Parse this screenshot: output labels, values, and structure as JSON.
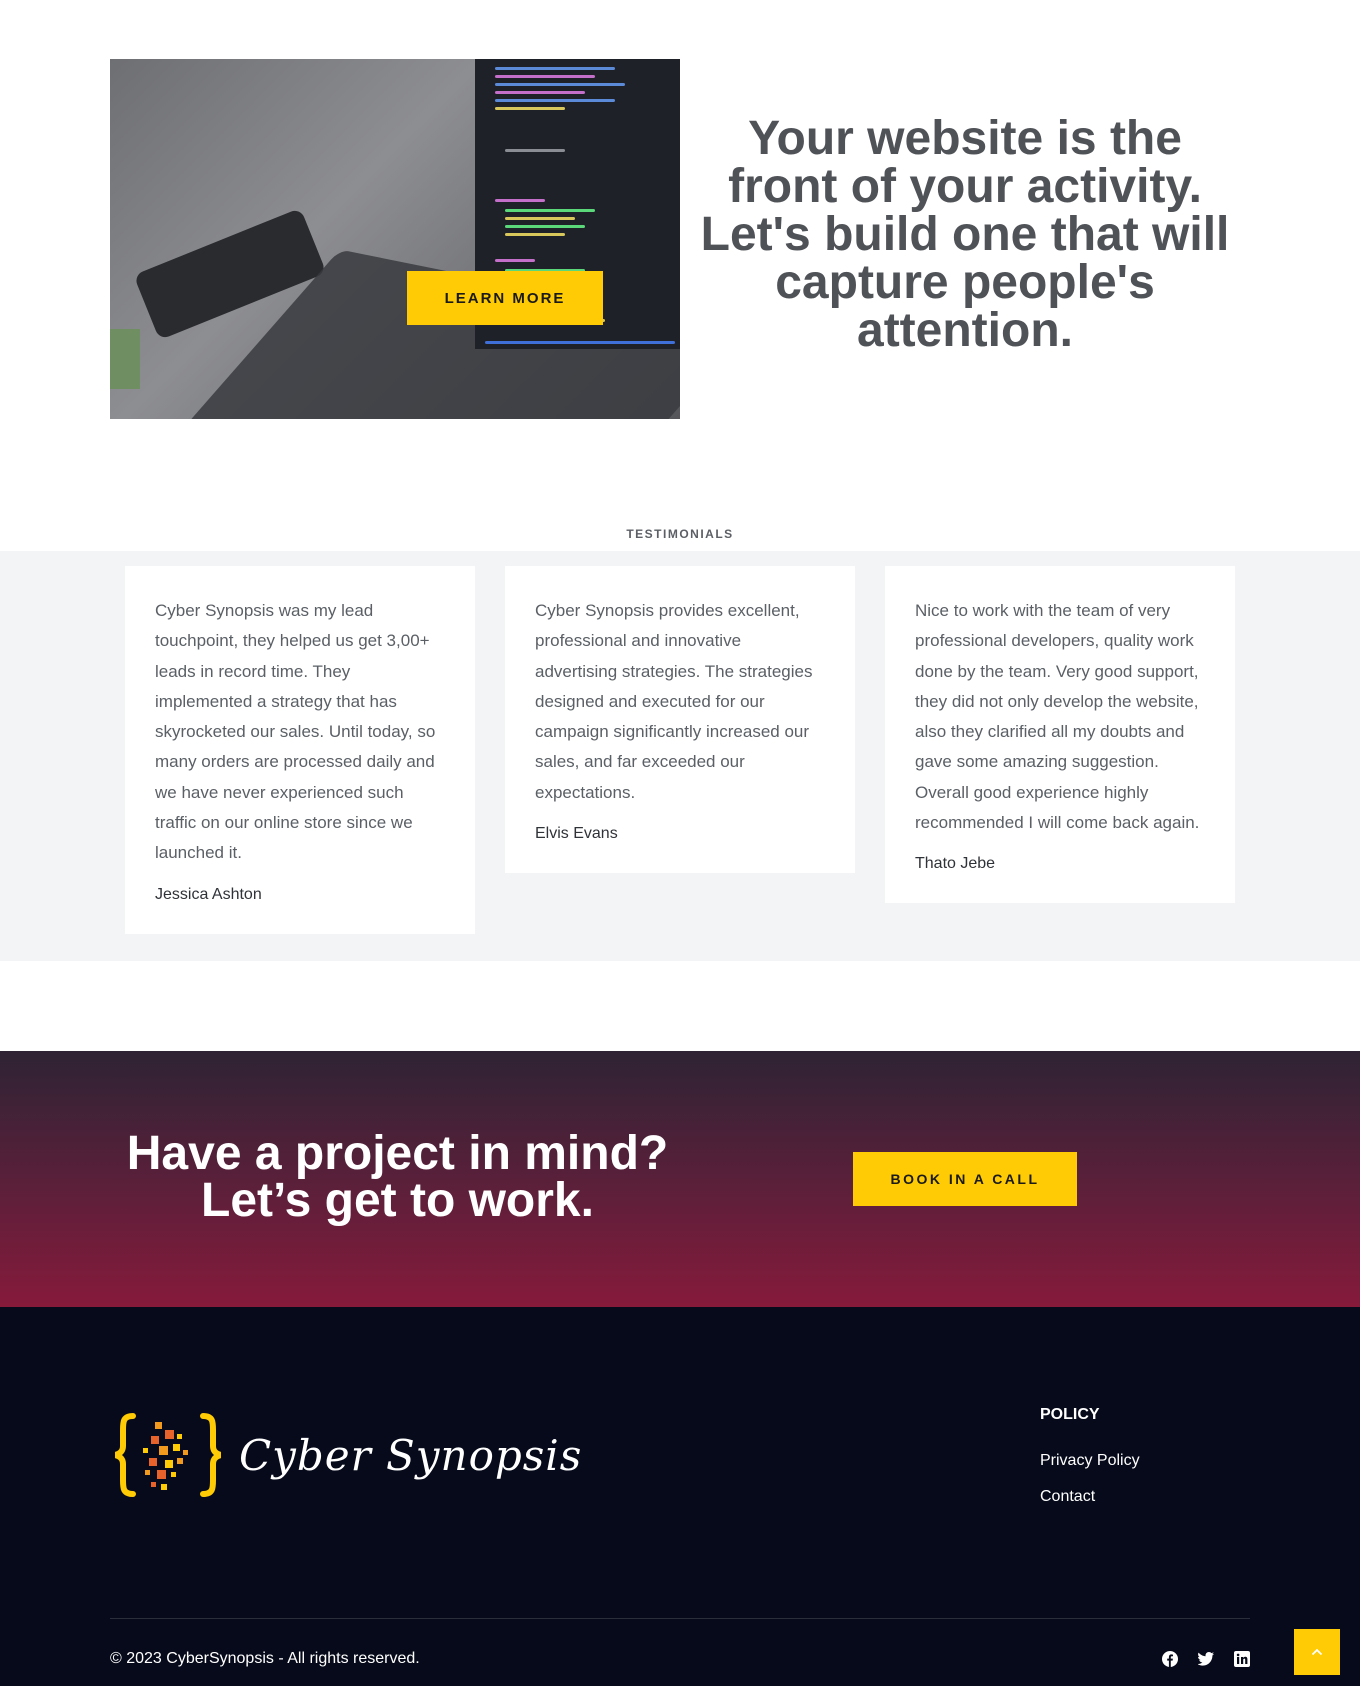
{
  "hero": {
    "learn_more_label": "LEARN MORE",
    "heading": "Your website is the front of your activity. Let's build one that will capture people's attention."
  },
  "testimonials": {
    "label": "TESTIMONIALS",
    "items": [
      {
        "text": "Cyber Synopsis was my lead touchpoint, they helped us get 3,00+ leads in record time. They implemented a strategy that has skyrocketed our sales. Until today, so many orders are processed daily and we have never experienced such traffic on our online store since we launched it.",
        "author": "Jessica Ashton"
      },
      {
        "text": "Cyber Synopsis provides excellent, professional and innovative advertising strategies. The strategies designed and executed for our campaign significantly increased our sales, and far exceeded our expectations.",
        "author": "Elvis Evans"
      },
      {
        "text": "Nice to work with the team of very professional developers, quality work done by the team. Very good support, they did not only develop the website, also they clarified all my doubts and gave some amazing suggestion. Overall good experience highly recommended I will come back again.",
        "author": "Thato Jebe"
      }
    ]
  },
  "cta": {
    "heading_line1": "Have a project in mind?",
    "heading_line2": "Let’s get to work.",
    "book_label": "BOOK IN A CALL"
  },
  "footer": {
    "logo_text": "Cyber Synopsis",
    "policy_title": "POLICY",
    "links": [
      "Privacy Policy",
      "Contact"
    ],
    "copyright": "© 2023 CyberSynopsis - All rights reserved.",
    "social_icons": [
      "facebook-icon",
      "twitter-icon",
      "linkedin-icon"
    ],
    "scroll_top_icon": "chevron-up-icon"
  },
  "colors": {
    "accent": "#ffcb05",
    "heading_gray": "#4f5257",
    "footer_bg": "#060a1a",
    "cta_top": "#2e2334",
    "cta_bottom": "#861a3b",
    "band_bg": "#f3f4f6"
  }
}
